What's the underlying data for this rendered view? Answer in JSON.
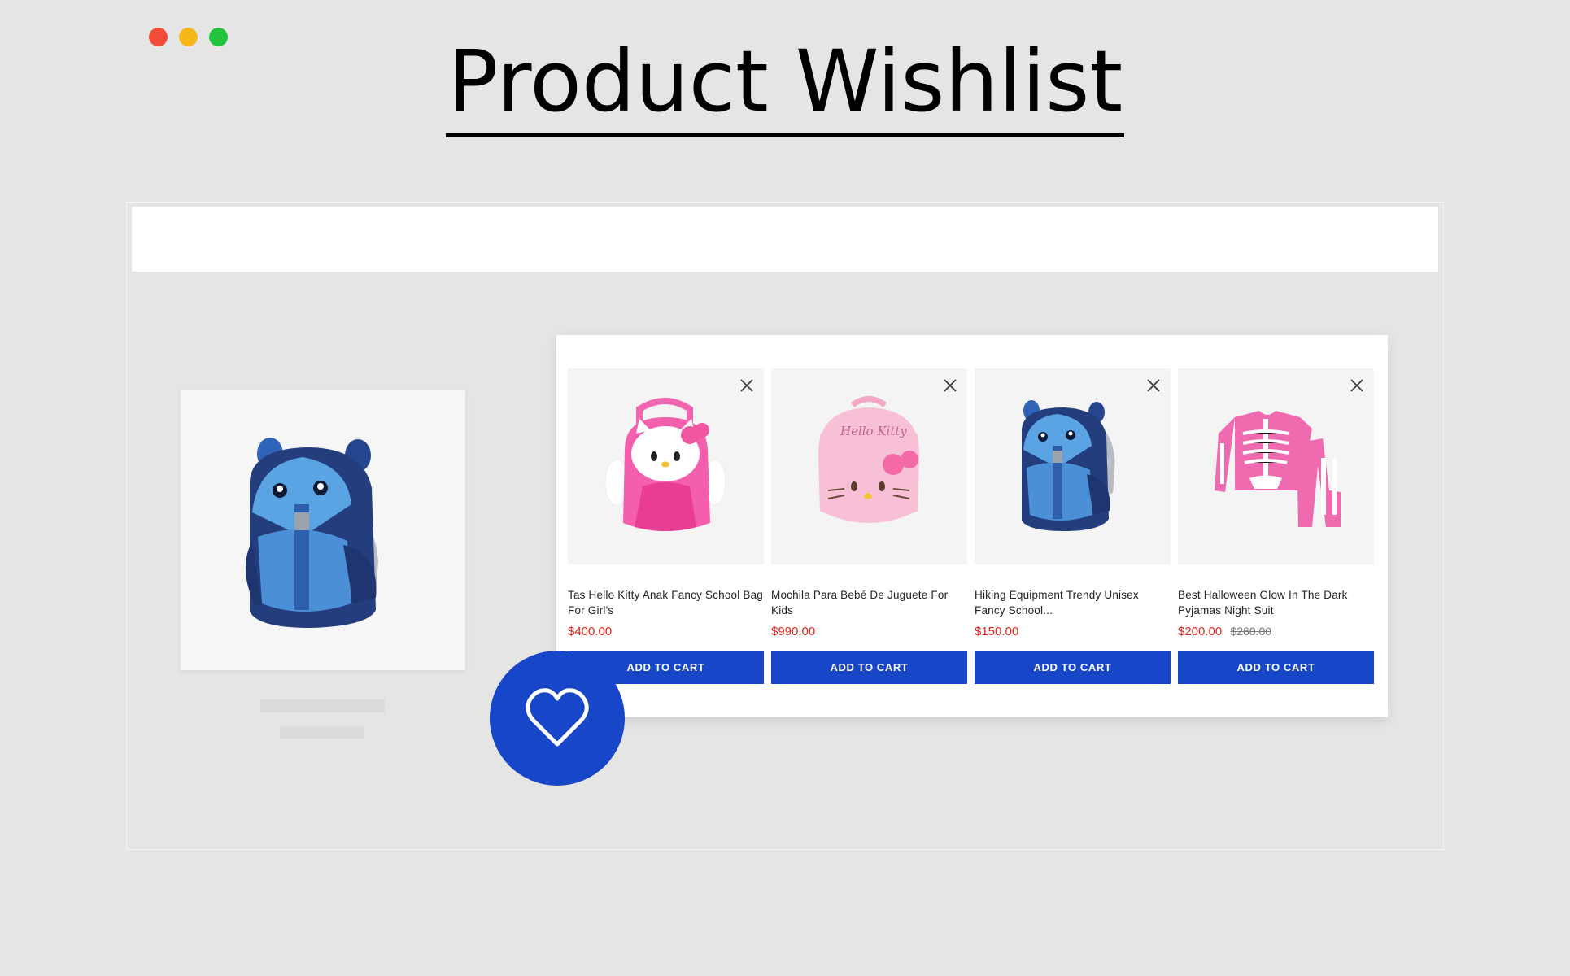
{
  "page": {
    "title": "Product Wishlist"
  },
  "window_controls": [
    {
      "name": "close",
      "color": "#f14c37"
    },
    {
      "name": "minimize",
      "color": "#f5b719"
    },
    {
      "name": "maximize",
      "color": "#21c43c"
    }
  ],
  "featured_product": {
    "image": "blue-kids-backpack-image"
  },
  "wishlist": {
    "items": [
      {
        "name": "Tas Hello Kitty Anak Fancy School Bag For Girl's",
        "price": "$400.00",
        "old_price": "",
        "button": "ADD TO CART",
        "image": "hello-kitty-angel-backpack-image"
      },
      {
        "name": "Mochila Para Bebé De Juguete For Kids",
        "price": "$990.00",
        "old_price": "",
        "button": "ADD TO CART",
        "image": "hello-kitty-pink-plush-bag-image"
      },
      {
        "name": "Hiking Equipment Trendy Unisex Fancy School...",
        "price": "$150.00",
        "old_price": "",
        "button": "ADD TO CART",
        "image": "blue-kids-backpack-image"
      },
      {
        "name": "Best Halloween Glow In The Dark Pyjamas Night Suit",
        "price": "$200.00",
        "old_price": "$260.00",
        "button": "ADD TO CART",
        "image": "skeleton-pyjamas-image"
      }
    ]
  },
  "colors": {
    "accent": "#1746c9",
    "price": "#e1261c",
    "background": "#e5e5e5"
  },
  "icons": {
    "remove": "close-icon",
    "wishlist": "heart-icon"
  }
}
